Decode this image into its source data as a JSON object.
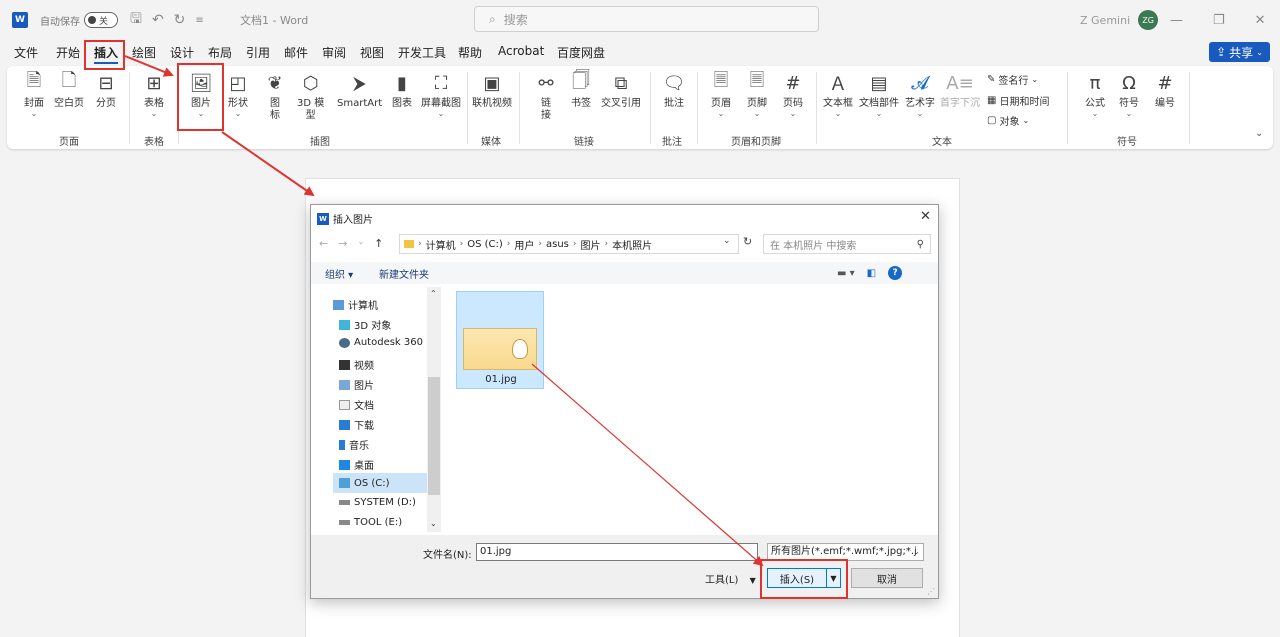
{
  "titlebar": {
    "autosave_label": "自动保存",
    "autosave_state": "关",
    "doc_title": "文档1 - Word",
    "search_placeholder": "搜索",
    "user_name": "Z Gemini",
    "user_initials": "ZG"
  },
  "tabs": [
    "文件",
    "开始",
    "插入",
    "绘图",
    "设计",
    "布局",
    "引用",
    "邮件",
    "审阅",
    "视图",
    "开发工具",
    "帮助",
    "Acrobat",
    "百度网盘"
  ],
  "active_tab": "插入",
  "share_label": "共享",
  "ribbon": {
    "buttons": {
      "cover": "封面",
      "blank": "空白页",
      "pagebreak": "分页",
      "table": "表格",
      "picture": "图片",
      "shapes": "形状",
      "icons": "图\n标",
      "model3d": "3D 模\n型",
      "smartart": "SmartArt",
      "chart": "图表",
      "screenshot": "屏幕截图",
      "video": "联机视频",
      "link": "链\n接",
      "bookmark": "书签",
      "crossref": "交叉引用",
      "comment": "批注",
      "header": "页眉",
      "footer": "页脚",
      "pagenum": "页码",
      "textbox": "文本框",
      "parts": "文档部件",
      "wordart": "艺术字",
      "dropcap": "首字下沉",
      "signature": "签名行",
      "datetime": "日期和时间",
      "object": "对象",
      "equation": "公式",
      "symbol": "符号",
      "number": "编号"
    },
    "groups": {
      "pages": "页面",
      "tables": "表格",
      "illustrations": "插图",
      "media": "媒体",
      "links": "链接",
      "comments": "批注",
      "headerfooter": "页眉和页脚",
      "text": "文本",
      "symbols": "符号"
    }
  },
  "dialog": {
    "title": "插入图片",
    "breadcrumb": [
      "计算机",
      "OS (C:)",
      "用户",
      "asus",
      "图片",
      "本机照片"
    ],
    "search_placeholder": "在 本机照片 中搜索",
    "organize": "组织 ▾",
    "new_folder": "新建文件夹",
    "nav_items": [
      "计算机",
      "3D 对象",
      "Autodesk 360",
      "视频",
      "图片",
      "文档",
      "下载",
      "音乐",
      "桌面",
      "OS (C:)",
      "SYSTEM (D:)",
      "TOOL (E:)"
    ],
    "selected_nav": "OS (C:)",
    "file_name": "01.jpg",
    "filename_label": "文件名(N):",
    "filename_value": "01.jpg",
    "filter": "所有图片(*.emf;*.wmf;*.jpg;*.j",
    "tools": "工具(L)",
    "insert": "插入(S)",
    "cancel": "取消"
  },
  "colors": {
    "accent": "#185abd",
    "highlight": "#e0332f",
    "selection": "#cce8ff"
  }
}
